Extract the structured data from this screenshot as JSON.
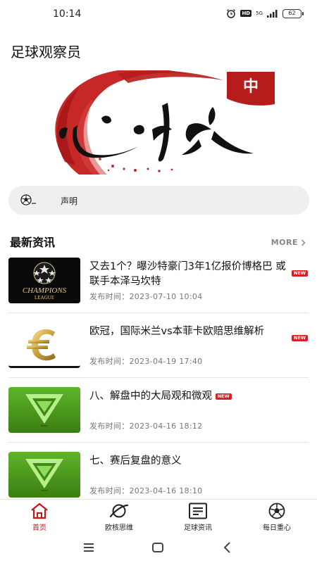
{
  "status_bar": {
    "time": "10:14",
    "network": "5G",
    "hd": "HD",
    "battery": "62"
  },
  "app": {
    "title": "足球观察员"
  },
  "banner": {
    "seal_text": "中",
    "icon": "calligraphy-banner"
  },
  "notice": {
    "label": "声明",
    "icon": "soccer-ball-icon"
  },
  "news_section": {
    "title": "最新资讯",
    "more_label": "MORE",
    "date_prefix": "发布时间：",
    "items": [
      {
        "title": "又去1个？曝沙特豪门3年1亿报价博格巴 或联手本泽马坎特",
        "date": "2023-07-10 10:04",
        "badge": "NEW",
        "thumb": "champions-league"
      },
      {
        "title": "欧冠，国际米兰vs本菲卡欧赔思维解析",
        "date": "2023-04-19 17:40",
        "badge": "NEW",
        "thumb": "euro-coin"
      },
      {
        "title": "八、解盘中的大局观和微观",
        "date": "2023-04-16 18:12",
        "badge": "NEW",
        "thumb": "green-triangle"
      },
      {
        "title": "七、赛后复盘的意义",
        "date": "2023-04-16 18:10",
        "badge": "",
        "thumb": "green-triangle"
      }
    ]
  },
  "tab_bar": {
    "tabs": [
      {
        "label": "首页",
        "icon": "home-icon",
        "active": true
      },
      {
        "label": "欧核思维",
        "icon": "orbit-icon",
        "active": false
      },
      {
        "label": "足球资讯",
        "icon": "news-icon",
        "active": false
      },
      {
        "label": "每日重心",
        "icon": "soccer-ball-icon",
        "active": false
      }
    ]
  },
  "colors": {
    "accent": "#c8161d",
    "badge": "#d71f26",
    "notice_bg": "#efefef",
    "thumb_green": "#4c9a1c"
  }
}
